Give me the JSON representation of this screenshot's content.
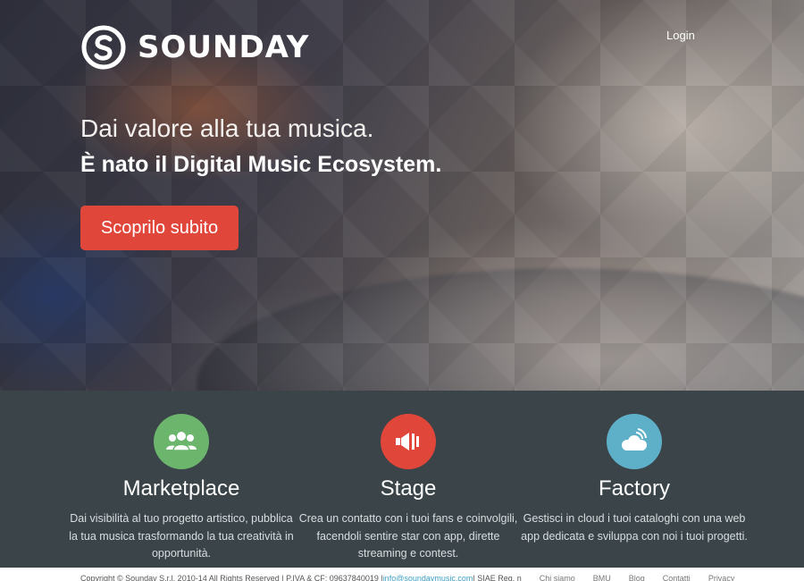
{
  "brand": {
    "name": "SOUNDAY"
  },
  "header": {
    "login_label": "Login"
  },
  "hero": {
    "line1": "Dai valore alla tua musica.",
    "line2": "È nato il Digital Music Ecosystem.",
    "cta_label": "Scoprilo subito"
  },
  "features": [
    {
      "title": "Marketplace",
      "description": "Dai visibilità al tuo progetto artistico, pubblica la tua musica trasformando la tua creatività in opportunità.",
      "icon": "people-icon",
      "color": "#6cb56d"
    },
    {
      "title": "Stage",
      "description": "Crea un contatto con i tuoi fans e coinvolgili, facendoli sentire star con app, dirette streaming e contest.",
      "icon": "megaphone-icon",
      "color": "#e0463a"
    },
    {
      "title": "Factory",
      "description": "Gestisci in cloud i tuoi cataloghi con una web app dedicata e sviluppa con noi i tuoi progetti.",
      "icon": "cloud-icon",
      "color": "#5eb0c8"
    }
  ],
  "footer": {
    "copyright": "Copyright © Sounday S.r.l. 2010-14 All Rights Reserved | P.IVA & CF: 09637840019 | ",
    "email": "info@soundaymusic.com",
    "siae": " | SIAE Reg. n",
    "links": [
      "Chi siamo",
      "BMU",
      "Blog",
      "Contatti",
      "Privacy"
    ]
  }
}
